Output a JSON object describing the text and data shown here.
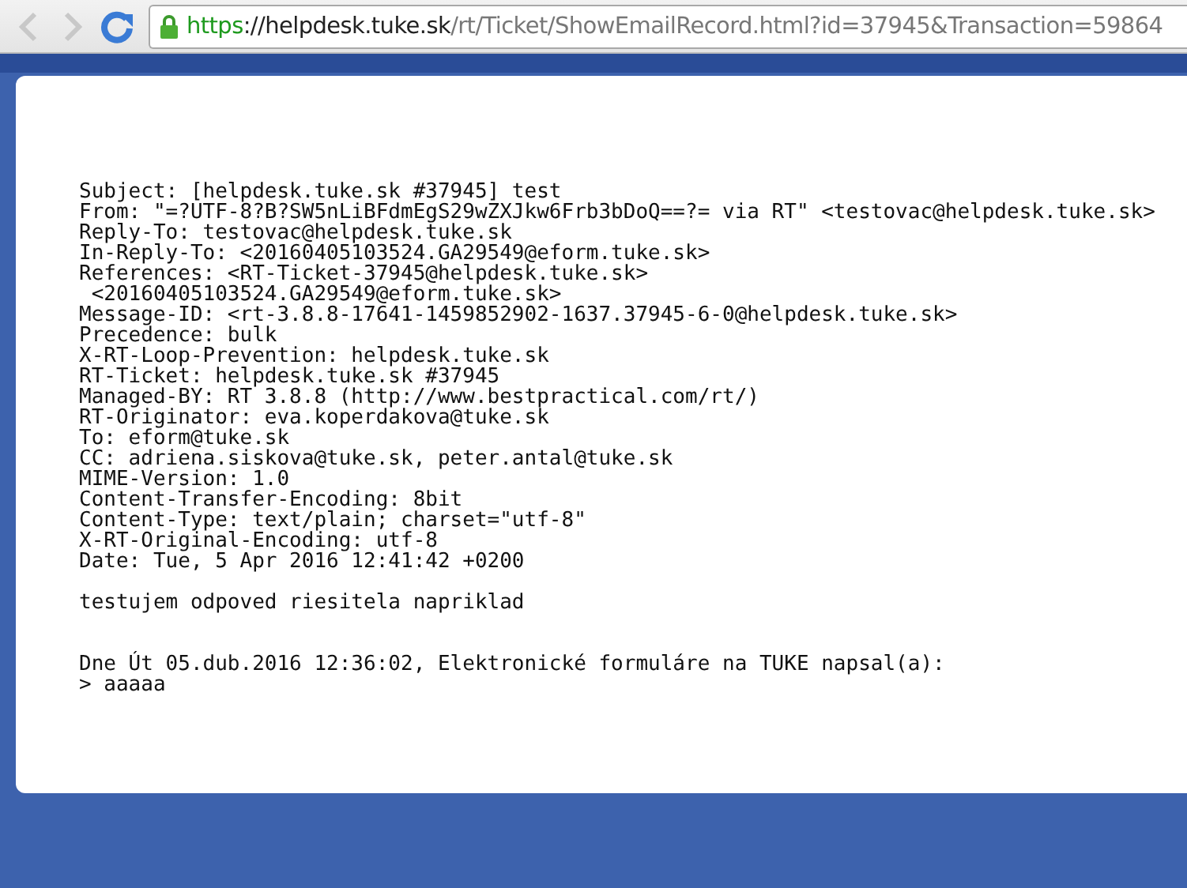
{
  "browser": {
    "url": {
      "scheme": "https",
      "separator": "://",
      "host": "helpdesk.tuke.sk",
      "path": "/rt/Ticket/ShowEmailRecord.html?id=37945&Transaction=59864"
    },
    "back_disabled": true,
    "forward_disabled": true,
    "secure": true
  },
  "email": {
    "headers": [
      "Subject: [helpdesk.tuke.sk #37945] test",
      "From: \"=?UTF-8?B?SW5nLiBFdmEgS29wZXJkw6Frb3bDoQ==?= via RT\" <testovac@helpdesk.tuke.sk>",
      "Reply-To: testovac@helpdesk.tuke.sk",
      "In-Reply-To: <20160405103524.GA29549@eform.tuke.sk>",
      "References: <RT-Ticket-37945@helpdesk.tuke.sk>",
      " <20160405103524.GA29549@eform.tuke.sk>",
      "Message-ID: <rt-3.8.8-17641-1459852902-1637.37945-6-0@helpdesk.tuke.sk>",
      "Precedence: bulk",
      "X-RT-Loop-Prevention: helpdesk.tuke.sk",
      "RT-Ticket: helpdesk.tuke.sk #37945",
      "Managed-BY: RT 3.8.8 (http://www.bestpractical.com/rt/)",
      "RT-Originator: eva.koperdakova@tuke.sk",
      "To: eform@tuke.sk",
      "CC: adriena.siskova@tuke.sk, peter.antal@tuke.sk",
      "MIME-Version: 1.0",
      "Content-Transfer-Encoding: 8bit",
      "Content-Type: text/plain; charset=\"utf-8\"",
      "X-RT-Original-Encoding: utf-8",
      "Date: Tue, 5 Apr 2016 12:41:42 +0200"
    ],
    "body": "testujem odpoved riesitela napriklad",
    "quote_intro": "Dne Út 05.dub.2016 12:36:02, Elektronické formuláre na TUKE napsal(a):",
    "quote_lines": [
      "> aaaaa"
    ]
  }
}
